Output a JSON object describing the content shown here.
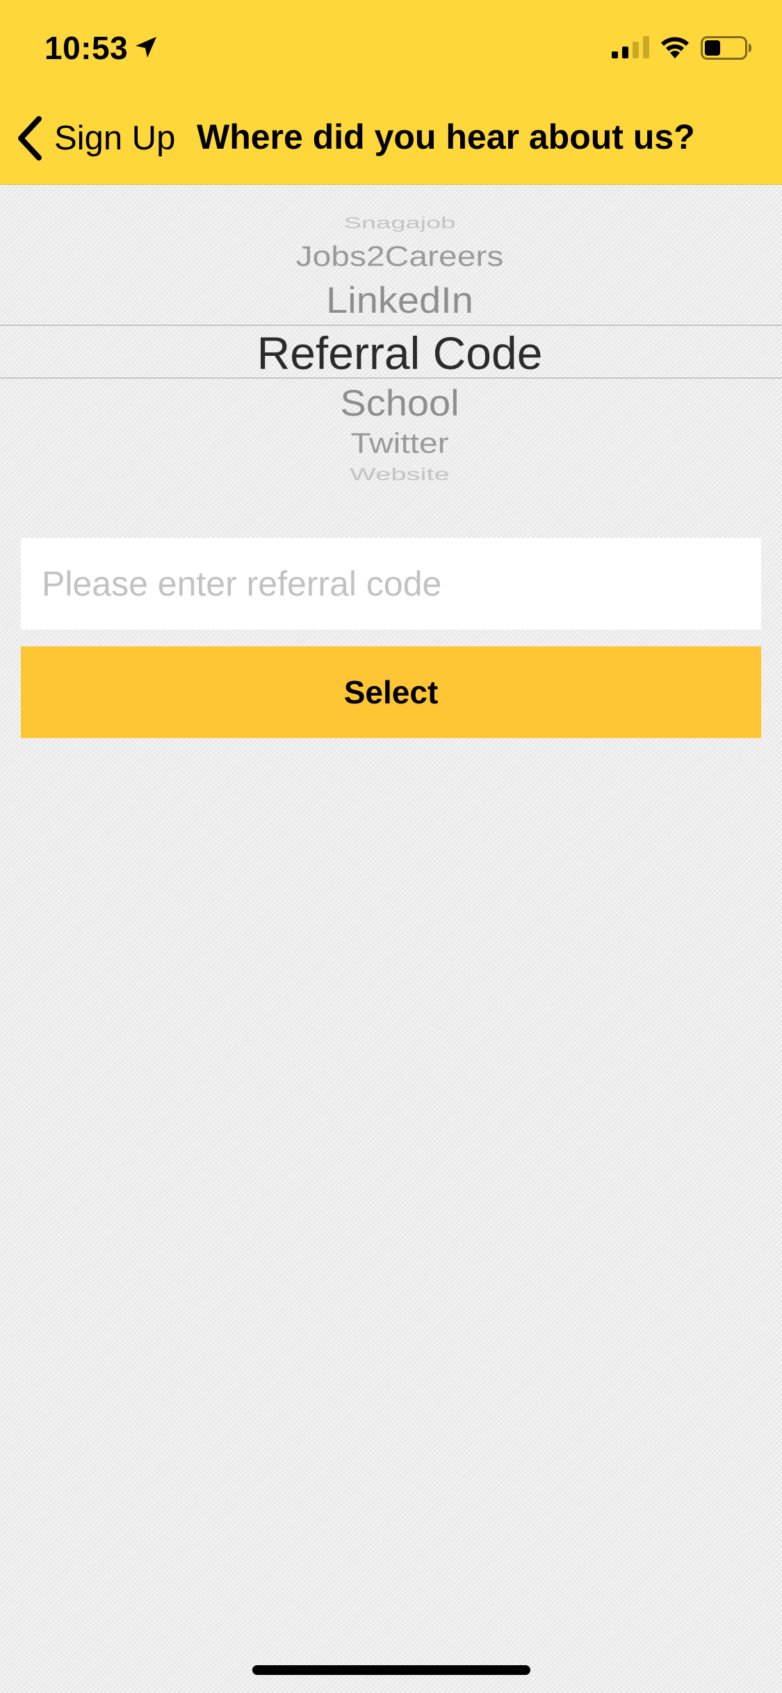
{
  "status_bar": {
    "time": "10:53",
    "location_icon": "location-arrow-icon",
    "signal_icon": "cellular-signal-icon",
    "wifi_icon": "wifi-icon",
    "battery_icon": "battery-icon"
  },
  "nav": {
    "back_label": "Sign Up",
    "title": "Where did you hear about us?",
    "background_color": "#fed73b"
  },
  "picker": {
    "items": [
      "Snagajob",
      "Jobs2Careers",
      "LinkedIn",
      "Referral Code",
      "School",
      "Twitter",
      "Website"
    ],
    "selected": "Referral Code"
  },
  "referral": {
    "placeholder": "Please enter referral code",
    "value": ""
  },
  "select_button": {
    "label": "Select",
    "color": "#fec535"
  }
}
